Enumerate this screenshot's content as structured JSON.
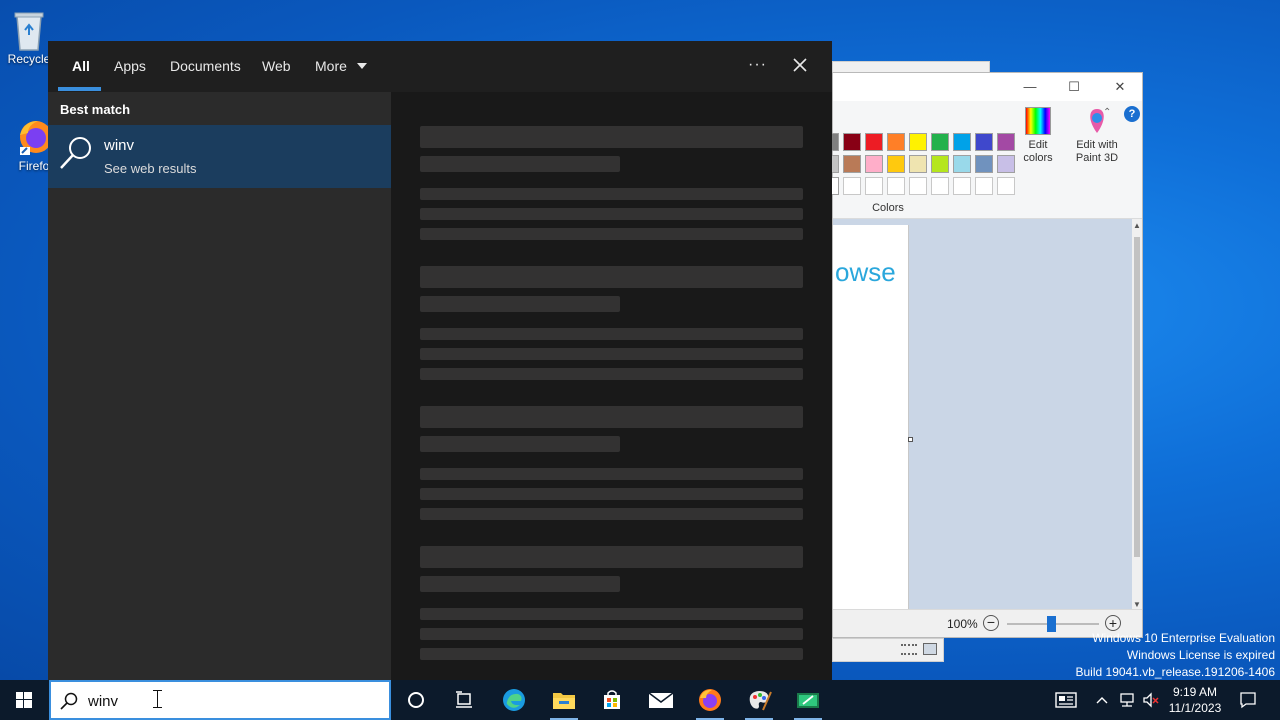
{
  "desktop": {
    "icons": [
      {
        "label": "Recycle"
      },
      {
        "label": "Firefo"
      }
    ]
  },
  "watermark": {
    "line1": "Windows 10 Enterprise Evaluation",
    "line2": "Windows License is expired",
    "line3": "Build 19041.vb_release.191206-1406"
  },
  "paint": {
    "help": "?",
    "edit_colors": "Edit colors",
    "edit_paint3d": "Edit with Paint 3D",
    "colors_group": "Colors",
    "canvas_text": "owse",
    "zoom": "100%",
    "palette_row1": [
      "#880015",
      "#ed1c24",
      "#ff7f27",
      "#fff200",
      "#22b14c",
      "#00a2e8",
      "#3f48cc",
      "#a349a4"
    ],
    "palette_row2": [
      "#b97a57",
      "#ffaec9",
      "#ffc90e",
      "#efe4b0",
      "#b5e61d",
      "#99d9ea",
      "#7092be",
      "#c8bfe7"
    ]
  },
  "search": {
    "tabs": [
      {
        "label": "All"
      },
      {
        "label": "Apps"
      },
      {
        "label": "Documents"
      },
      {
        "label": "Web"
      },
      {
        "label": "More"
      }
    ],
    "more_options": "···",
    "best_match_header": "Best match",
    "result": {
      "title": "winv",
      "subtitle": "See web results"
    },
    "query": "winv"
  },
  "taskbar": {
    "clock_time": "9:19 AM",
    "clock_date": "11/1/2023"
  },
  "colors": {
    "accent": "#3a8fde",
    "taskbar": "#0c1a2b",
    "result_highlight": "#1b3d5e"
  }
}
